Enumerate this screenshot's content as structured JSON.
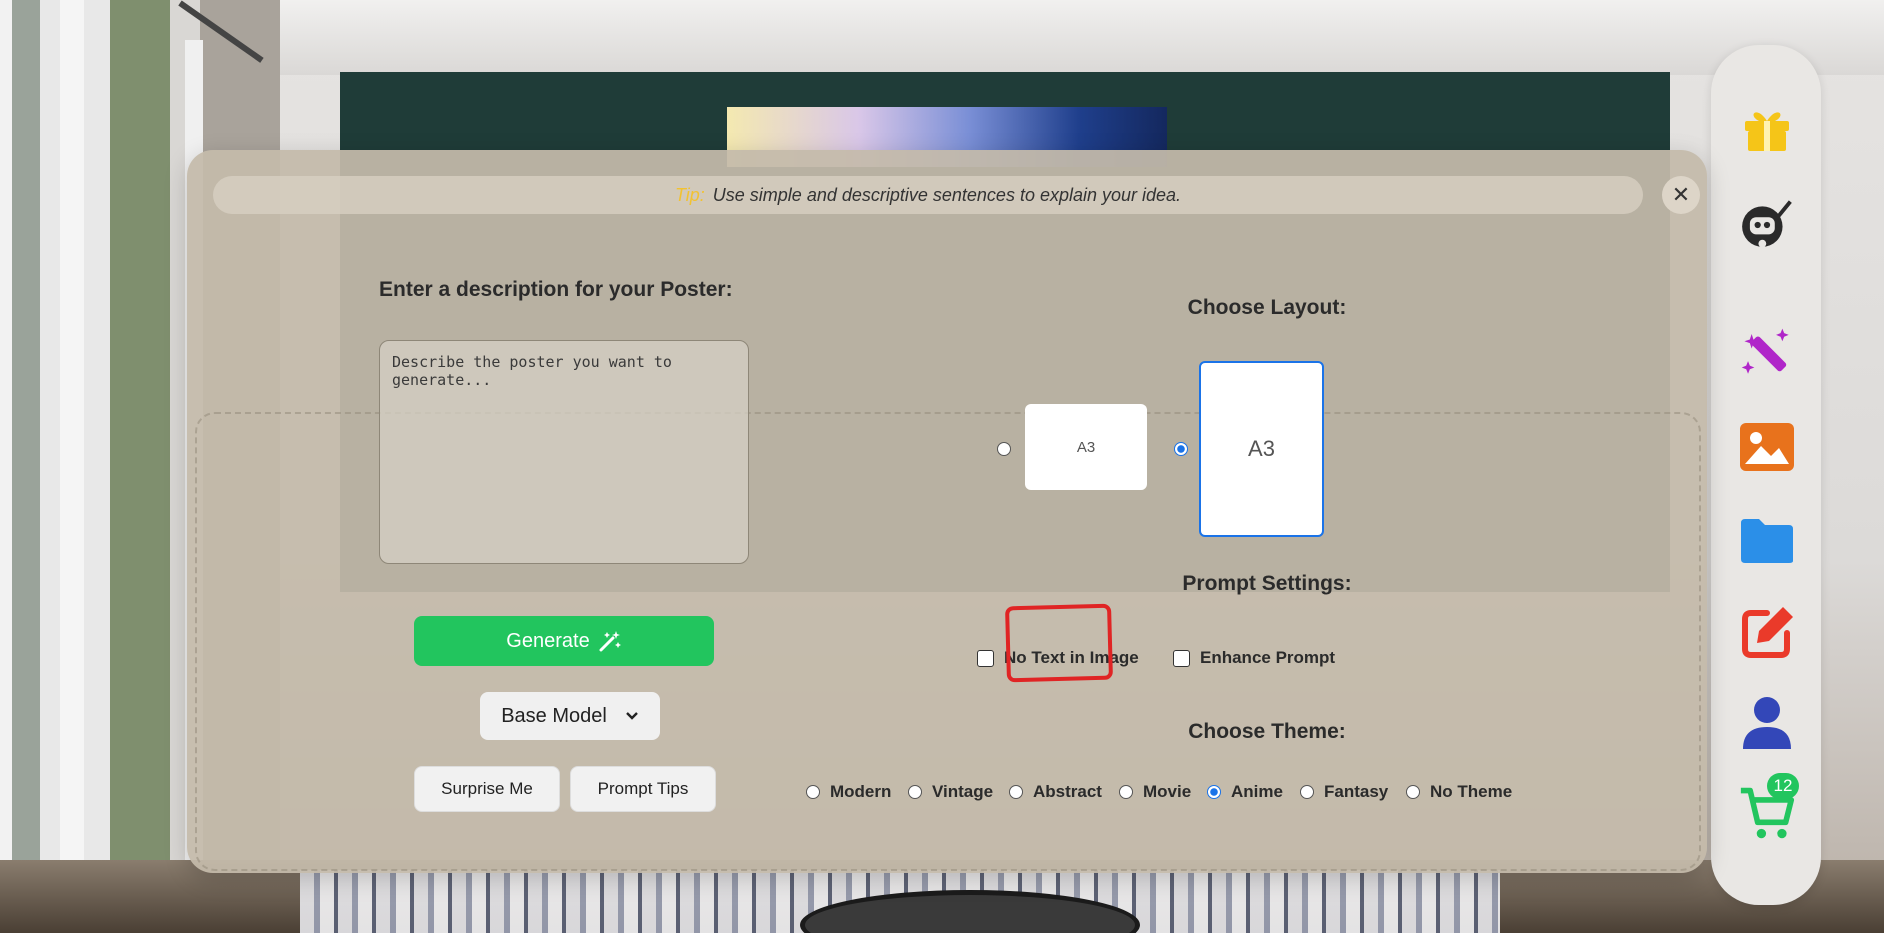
{
  "tip": {
    "label": "Tip:",
    "text": "Use simple and descriptive sentences to explain your idea."
  },
  "description": {
    "label": "Enter a description for your Poster:",
    "placeholder": "Describe the poster you want to generate..."
  },
  "actions": {
    "generate_label": "Generate",
    "model_selected": "Base Model",
    "surprise_label": "Surprise Me",
    "prompt_tips_label": "Prompt Tips"
  },
  "layout": {
    "title": "Choose Layout:",
    "options": [
      {
        "label": "A3",
        "orientation": "landscape",
        "selected": false
      },
      {
        "label": "A3",
        "orientation": "portrait",
        "selected": true
      }
    ]
  },
  "prompt_settings": {
    "title": "Prompt Settings:",
    "options": [
      {
        "label": "No Text in Image",
        "checked": false
      },
      {
        "label": "Enhance Prompt",
        "checked": false
      }
    ]
  },
  "theme": {
    "title": "Choose Theme:",
    "selected": "Anime",
    "options": [
      "Modern",
      "Vintage",
      "Abstract",
      "Movie",
      "Anime",
      "Fantasy",
      "No Theme"
    ]
  },
  "sidebar": {
    "items": [
      {
        "icon": "gift-icon"
      },
      {
        "icon": "robot-artist-icon"
      },
      {
        "icon": "magic-wand-icon"
      },
      {
        "icon": "image-icon"
      },
      {
        "icon": "folder-icon"
      },
      {
        "icon": "edit-icon"
      },
      {
        "icon": "user-icon"
      },
      {
        "icon": "cart-icon",
        "badge": "12"
      }
    ]
  },
  "colors": {
    "accent_green": "#22c55e",
    "tip_yellow": "#f2c230",
    "selection_blue": "#1a73e8",
    "annotation_red": "#e02424"
  }
}
